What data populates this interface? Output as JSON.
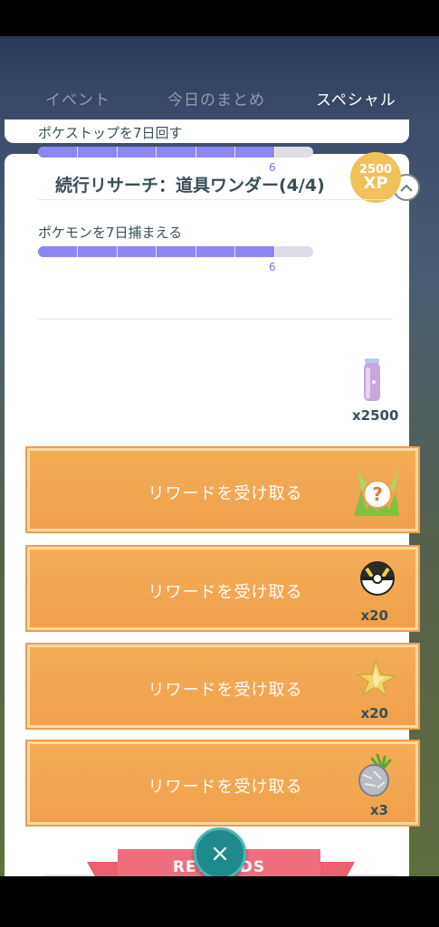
{
  "tabs": [
    {
      "label": "イベント",
      "active": false
    },
    {
      "label": "今日のまとめ",
      "active": false
    },
    {
      "label": "スペシャル",
      "active": true
    }
  ],
  "research": {
    "title": "続行リサーチ：道具ワンダー(4/4)",
    "tasks": [
      {
        "label": "ポケストップを7日回す",
        "progress_count": "6",
        "progress_fraction": 0.857,
        "reward": {
          "icon": "xp-badge",
          "value": "2500",
          "unit": "XP"
        }
      },
      {
        "label": "ポケモンを7日捕まえる",
        "progress_count": "6",
        "progress_fraction": 0.857,
        "reward": {
          "icon": "stardust-icon",
          "quantity": "x2500"
        }
      }
    ],
    "claim_rewards": [
      {
        "label": "リワードを受け取る",
        "icon": "mystery-encounter-icon",
        "quantity": ""
      },
      {
        "label": "リワードを受け取る",
        "icon": "ultra-ball-icon",
        "quantity": "x20"
      },
      {
        "label": "リワードを受け取る",
        "icon": "stardust-star-piece-icon",
        "quantity": "x20"
      },
      {
        "label": "リワードを受け取る",
        "icon": "silver-pinap-berry-icon",
        "quantity": "x3"
      }
    ]
  },
  "footer": {
    "ribbon_label": "REWARDS",
    "close_icon": "close-icon"
  },
  "colors": {
    "accent": "#f4ae57",
    "progress": "#8e86f2",
    "ribbon": "#ef6e7e",
    "fab": "#1f8a8c"
  }
}
